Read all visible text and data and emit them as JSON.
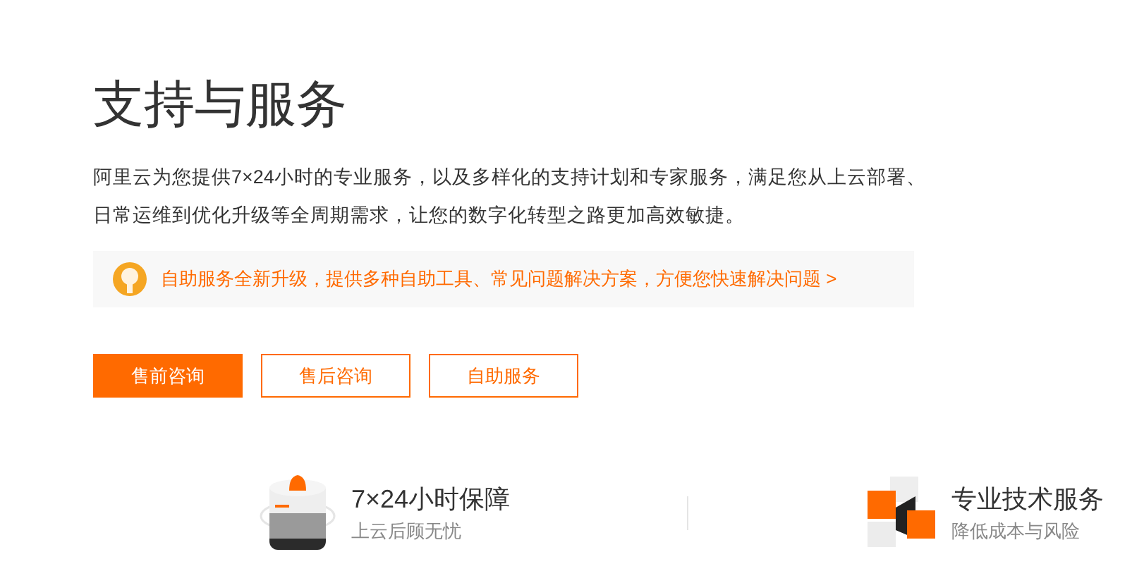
{
  "title": "支持与服务",
  "description": "阿里云为您提供7×24小时的专业服务，以及多样化的支持计划和专家服务，满足您从上云部署、日常运维到优化升级等全周期需求，让您的数字化转型之路更加高效敏捷。",
  "notice": {
    "text": "自助服务全新升级，提供多种自助工具、常见问题解决方案，方便您快速解决问题 >"
  },
  "buttons": [
    {
      "label": "售前咨询",
      "kind": "primary"
    },
    {
      "label": "售后咨询",
      "kind": "outline"
    },
    {
      "label": "自助服务",
      "kind": "outline"
    }
  ],
  "features": [
    {
      "title": "7×24小时保障",
      "subtitle": "上云后顾无忧",
      "kind": "device"
    },
    {
      "title": "专业技术服务",
      "subtitle": "降低成本与风险",
      "kind": "cubes"
    }
  ]
}
